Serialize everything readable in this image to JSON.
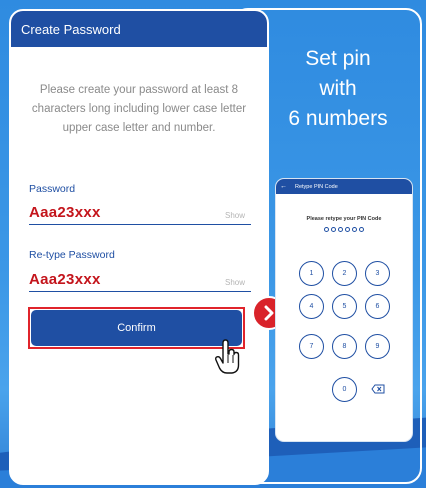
{
  "left_screen": {
    "header_title": "Create Password",
    "description": "Please create your password at least 8 characters long including lower case letter upper case letter and number.",
    "password": {
      "label": "Password",
      "value": "Aaa23xxx",
      "show": "Show"
    },
    "retype": {
      "label": "Re-type Password",
      "value": "Aaa23xxx",
      "show": "Show"
    },
    "confirm_label": "Confirm"
  },
  "caption": {
    "line1": "Set pin",
    "line2": "with",
    "line3": "6 numbers"
  },
  "right_screen": {
    "header_title": "Retype PIN Code",
    "prompt": "Please retype your PIN Code",
    "pin_dots": 6,
    "keys": [
      "1",
      "2",
      "3",
      "4",
      "5",
      "6",
      "7",
      "8",
      "9",
      "0"
    ]
  },
  "colors": {
    "primary": "#1f4fa3",
    "accent_red": "#d9232a",
    "background": "#3a93e0"
  }
}
